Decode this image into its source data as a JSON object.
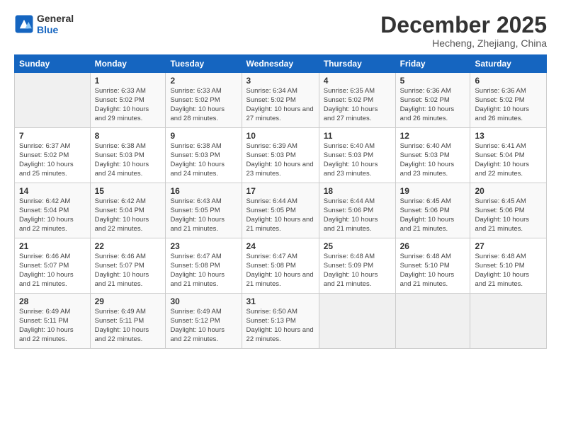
{
  "header": {
    "logo_line1": "General",
    "logo_line2": "Blue",
    "month": "December 2025",
    "location": "Hecheng, Zhejiang, China"
  },
  "days_of_week": [
    "Sunday",
    "Monday",
    "Tuesday",
    "Wednesday",
    "Thursday",
    "Friday",
    "Saturday"
  ],
  "weeks": [
    [
      {
        "day": "",
        "sunrise": "",
        "sunset": "",
        "daylight": ""
      },
      {
        "day": "1",
        "sunrise": "Sunrise: 6:33 AM",
        "sunset": "Sunset: 5:02 PM",
        "daylight": "Daylight: 10 hours and 29 minutes."
      },
      {
        "day": "2",
        "sunrise": "Sunrise: 6:33 AM",
        "sunset": "Sunset: 5:02 PM",
        "daylight": "Daylight: 10 hours and 28 minutes."
      },
      {
        "day": "3",
        "sunrise": "Sunrise: 6:34 AM",
        "sunset": "Sunset: 5:02 PM",
        "daylight": "Daylight: 10 hours and 27 minutes."
      },
      {
        "day": "4",
        "sunrise": "Sunrise: 6:35 AM",
        "sunset": "Sunset: 5:02 PM",
        "daylight": "Daylight: 10 hours and 27 minutes."
      },
      {
        "day": "5",
        "sunrise": "Sunrise: 6:36 AM",
        "sunset": "Sunset: 5:02 PM",
        "daylight": "Daylight: 10 hours and 26 minutes."
      },
      {
        "day": "6",
        "sunrise": "Sunrise: 6:36 AM",
        "sunset": "Sunset: 5:02 PM",
        "daylight": "Daylight: 10 hours and 26 minutes."
      }
    ],
    [
      {
        "day": "7",
        "sunrise": "Sunrise: 6:37 AM",
        "sunset": "Sunset: 5:02 PM",
        "daylight": "Daylight: 10 hours and 25 minutes."
      },
      {
        "day": "8",
        "sunrise": "Sunrise: 6:38 AM",
        "sunset": "Sunset: 5:03 PM",
        "daylight": "Daylight: 10 hours and 24 minutes."
      },
      {
        "day": "9",
        "sunrise": "Sunrise: 6:38 AM",
        "sunset": "Sunset: 5:03 PM",
        "daylight": "Daylight: 10 hours and 24 minutes."
      },
      {
        "day": "10",
        "sunrise": "Sunrise: 6:39 AM",
        "sunset": "Sunset: 5:03 PM",
        "daylight": "Daylight: 10 hours and 23 minutes."
      },
      {
        "day": "11",
        "sunrise": "Sunrise: 6:40 AM",
        "sunset": "Sunset: 5:03 PM",
        "daylight": "Daylight: 10 hours and 23 minutes."
      },
      {
        "day": "12",
        "sunrise": "Sunrise: 6:40 AM",
        "sunset": "Sunset: 5:03 PM",
        "daylight": "Daylight: 10 hours and 23 minutes."
      },
      {
        "day": "13",
        "sunrise": "Sunrise: 6:41 AM",
        "sunset": "Sunset: 5:04 PM",
        "daylight": "Daylight: 10 hours and 22 minutes."
      }
    ],
    [
      {
        "day": "14",
        "sunrise": "Sunrise: 6:42 AM",
        "sunset": "Sunset: 5:04 PM",
        "daylight": "Daylight: 10 hours and 22 minutes."
      },
      {
        "day": "15",
        "sunrise": "Sunrise: 6:42 AM",
        "sunset": "Sunset: 5:04 PM",
        "daylight": "Daylight: 10 hours and 22 minutes."
      },
      {
        "day": "16",
        "sunrise": "Sunrise: 6:43 AM",
        "sunset": "Sunset: 5:05 PM",
        "daylight": "Daylight: 10 hours and 21 minutes."
      },
      {
        "day": "17",
        "sunrise": "Sunrise: 6:44 AM",
        "sunset": "Sunset: 5:05 PM",
        "daylight": "Daylight: 10 hours and 21 minutes."
      },
      {
        "day": "18",
        "sunrise": "Sunrise: 6:44 AM",
        "sunset": "Sunset: 5:06 PM",
        "daylight": "Daylight: 10 hours and 21 minutes."
      },
      {
        "day": "19",
        "sunrise": "Sunrise: 6:45 AM",
        "sunset": "Sunset: 5:06 PM",
        "daylight": "Daylight: 10 hours and 21 minutes."
      },
      {
        "day": "20",
        "sunrise": "Sunrise: 6:45 AM",
        "sunset": "Sunset: 5:06 PM",
        "daylight": "Daylight: 10 hours and 21 minutes."
      }
    ],
    [
      {
        "day": "21",
        "sunrise": "Sunrise: 6:46 AM",
        "sunset": "Sunset: 5:07 PM",
        "daylight": "Daylight: 10 hours and 21 minutes."
      },
      {
        "day": "22",
        "sunrise": "Sunrise: 6:46 AM",
        "sunset": "Sunset: 5:07 PM",
        "daylight": "Daylight: 10 hours and 21 minutes."
      },
      {
        "day": "23",
        "sunrise": "Sunrise: 6:47 AM",
        "sunset": "Sunset: 5:08 PM",
        "daylight": "Daylight: 10 hours and 21 minutes."
      },
      {
        "day": "24",
        "sunrise": "Sunrise: 6:47 AM",
        "sunset": "Sunset: 5:08 PM",
        "daylight": "Daylight: 10 hours and 21 minutes."
      },
      {
        "day": "25",
        "sunrise": "Sunrise: 6:48 AM",
        "sunset": "Sunset: 5:09 PM",
        "daylight": "Daylight: 10 hours and 21 minutes."
      },
      {
        "day": "26",
        "sunrise": "Sunrise: 6:48 AM",
        "sunset": "Sunset: 5:10 PM",
        "daylight": "Daylight: 10 hours and 21 minutes."
      },
      {
        "day": "27",
        "sunrise": "Sunrise: 6:48 AM",
        "sunset": "Sunset: 5:10 PM",
        "daylight": "Daylight: 10 hours and 21 minutes."
      }
    ],
    [
      {
        "day": "28",
        "sunrise": "Sunrise: 6:49 AM",
        "sunset": "Sunset: 5:11 PM",
        "daylight": "Daylight: 10 hours and 22 minutes."
      },
      {
        "day": "29",
        "sunrise": "Sunrise: 6:49 AM",
        "sunset": "Sunset: 5:11 PM",
        "daylight": "Daylight: 10 hours and 22 minutes."
      },
      {
        "day": "30",
        "sunrise": "Sunrise: 6:49 AM",
        "sunset": "Sunset: 5:12 PM",
        "daylight": "Daylight: 10 hours and 22 minutes."
      },
      {
        "day": "31",
        "sunrise": "Sunrise: 6:50 AM",
        "sunset": "Sunset: 5:13 PM",
        "daylight": "Daylight: 10 hours and 22 minutes."
      },
      {
        "day": "",
        "sunrise": "",
        "sunset": "",
        "daylight": ""
      },
      {
        "day": "",
        "sunrise": "",
        "sunset": "",
        "daylight": ""
      },
      {
        "day": "",
        "sunrise": "",
        "sunset": "",
        "daylight": ""
      }
    ]
  ]
}
